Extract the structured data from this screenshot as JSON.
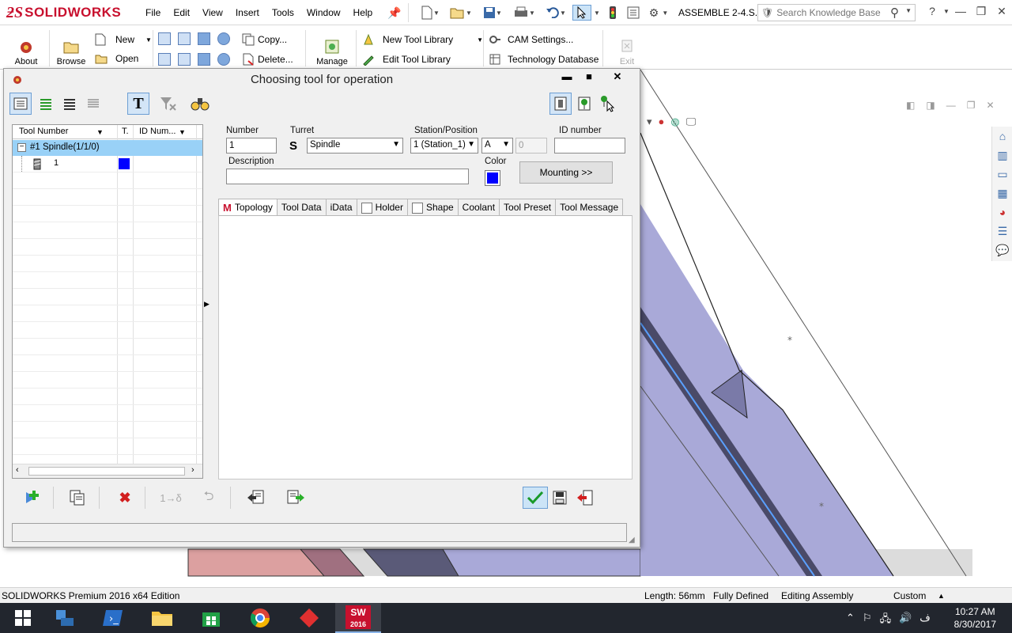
{
  "app": {
    "logo_text": "SOLIDWORKS",
    "menu": [
      "File",
      "Edit",
      "View",
      "Insert",
      "Tools",
      "Window",
      "Help"
    ],
    "document_title": "ASSEMBLE 2-4.S...",
    "search_placeholder": "Search Knowledge Base"
  },
  "ribbon": {
    "about": "About",
    "browse": "Browse",
    "new": "New",
    "open": "Open",
    "copy": "Copy...",
    "delete": "Delete...",
    "manage": "Manage",
    "new_tool_library": "New Tool Library",
    "edit_tool_library": "Edit Tool Library",
    "cam_settings": "CAM Settings...",
    "technology_database": "Technology Database",
    "exit": "Exit"
  },
  "dialog": {
    "title": "Choosing tool for operation",
    "tree": {
      "columns": [
        "Tool Number",
        "T.",
        "ID Num..."
      ],
      "rows": [
        {
          "label": "#1 Spindle(1/1/0)",
          "level": 0
        },
        {
          "label": "1",
          "level": 1,
          "color": "#0000ff"
        }
      ]
    },
    "form": {
      "number_label": "Number",
      "number_value": "1",
      "turret_label": "Turret",
      "turret_value": "Spindle",
      "station_label": "Station/Position",
      "station_value": "1 (Station_1)",
      "position_value": "A",
      "position_index": "0",
      "id_label": "ID number",
      "id_value": "",
      "description_label": "Description",
      "description_value": "",
      "color_label": "Color",
      "color_value": "#0000ff",
      "mounting_button": "Mounting >>"
    },
    "tabs": [
      {
        "label": "Topology",
        "badge": "M",
        "checkbox": false
      },
      {
        "label": "Tool Data",
        "checkbox": false
      },
      {
        "label": "iData",
        "checkbox": false
      },
      {
        "label": "Holder",
        "checkbox": true
      },
      {
        "label": "Shape",
        "checkbox": true
      },
      {
        "label": "Coolant",
        "checkbox": false
      },
      {
        "label": "Tool Preset",
        "checkbox": false
      },
      {
        "label": "Tool Message",
        "checkbox": false
      }
    ],
    "status_text": ""
  },
  "statusbar": {
    "edition": "SOLIDWORKS Premium 2016 x64 Edition",
    "length": "Length: 56mm",
    "defined": "Fully Defined",
    "mode": "Editing Assembly",
    "units": "Custom"
  },
  "taskbar": {
    "time": "10:27 AM",
    "date": "8/30/2017",
    "sw_badge": "2016",
    "lang": "ف"
  },
  "colors": {
    "selection": "#99d1f7",
    "brand_red": "#c8102e",
    "model_face": "#a9a9d8",
    "tool_color": "#0000ff"
  }
}
